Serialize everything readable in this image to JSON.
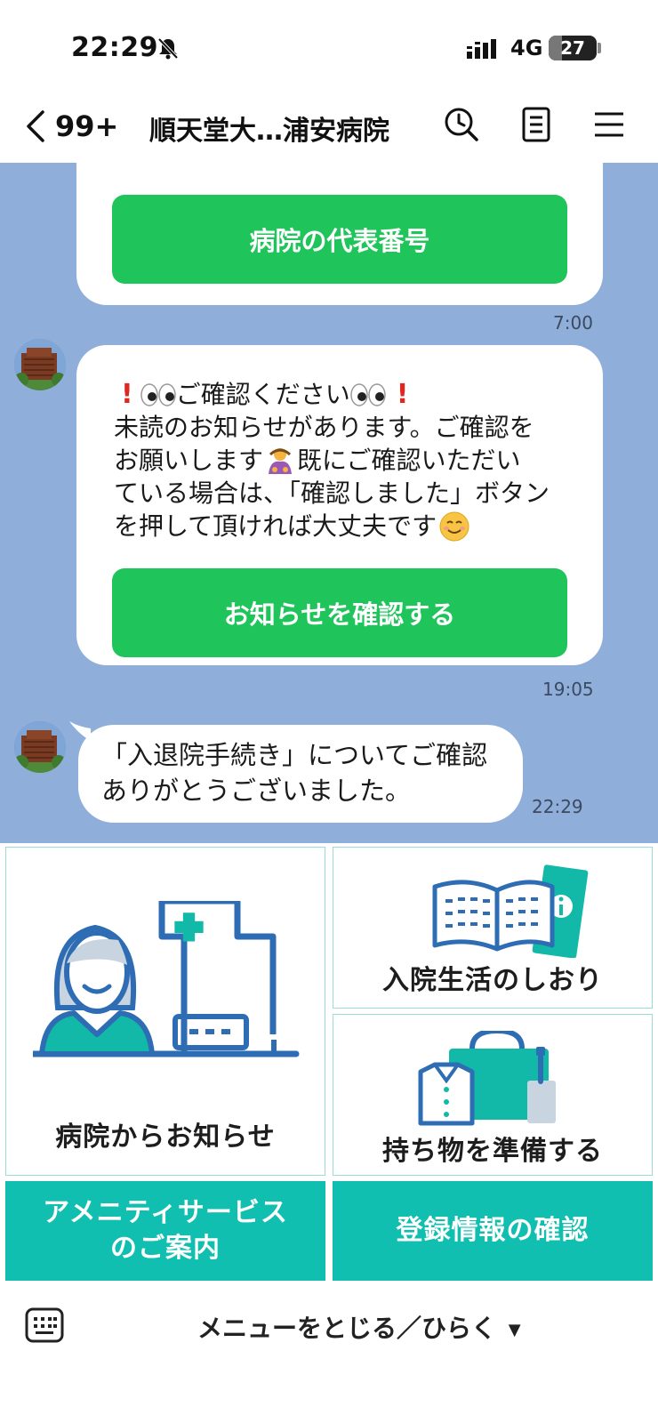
{
  "status_bar": {
    "time": "22:29",
    "network": "4G",
    "battery_level": "27",
    "battery_fraction": 0.27
  },
  "header": {
    "unread_count": "99+",
    "title": "順天堂大…浦安病院"
  },
  "messages": [
    {
      "button_label": "病院の代表番号",
      "time": "7:00"
    },
    {
      "line1_text": "ご確認ください",
      "lines": [
        "未読のお知らせがあります。ご確認を",
        "お願いします",
        "既にご確認いただい",
        "ている場合は、「確認しました」ボタン",
        "を押して頂ければ大丈夫です"
      ],
      "button_label": "お知らせを確認する",
      "time": "19:05"
    },
    {
      "lines": [
        "「入退院手続き」についてご確認",
        "ありがとうございました。"
      ],
      "time": "22:29"
    }
  ],
  "rich_menu": {
    "notices_label": "病院からお知らせ",
    "guide_label": "入院生活のしおり",
    "belongings_label": "持ち物を準備する",
    "amenity_line1": "アメニティサービス",
    "amenity_line2": "のご案内",
    "registration_label": "登録情報の確認"
  },
  "bottom_bar": {
    "toggle_label": "メニューをとじる／ひらく"
  },
  "colors": {
    "chat_background": "#8faed9",
    "line_green": "#1fc55a",
    "menu_teal": "#11bfb0",
    "menu_border": "#9bded4",
    "icon_blue": "#2e6db4"
  }
}
